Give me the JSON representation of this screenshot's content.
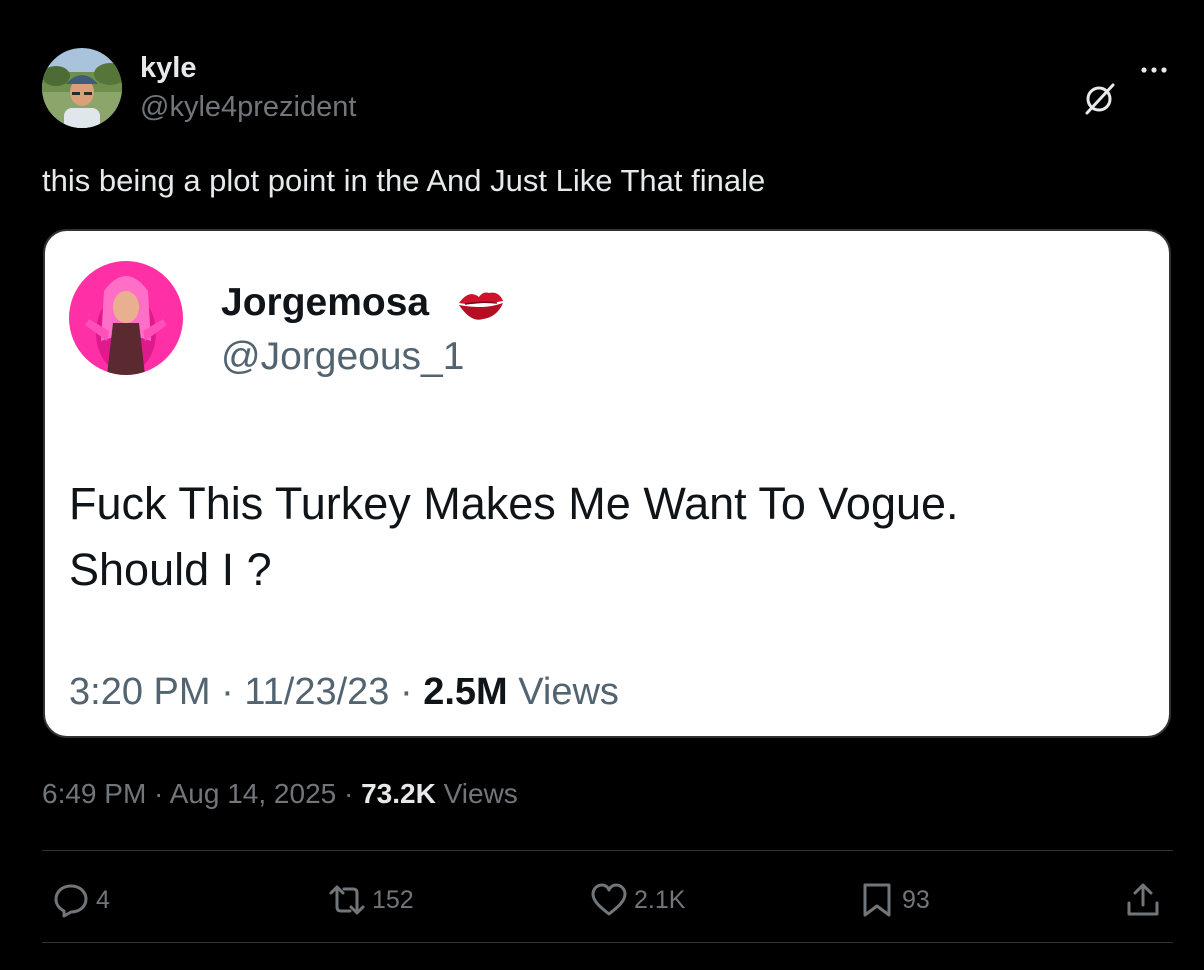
{
  "author": {
    "name": "kyle",
    "handle": "@kyle4prezident"
  },
  "tweet": {
    "text": "this being a plot point in the And Just Like That finale"
  },
  "quoted": {
    "name": "Jorgemosa",
    "handle": "@Jorgeous_1",
    "text_line1": "Fuck This Turkey Makes Me Want To Vogue.",
    "text_line2": "Should I ?",
    "time": "3:20 PM",
    "date": "11/23/23",
    "views_count": "2.5M",
    "views_label": "Views"
  },
  "meta": {
    "time": "6:49 PM",
    "date": "Aug 14, 2025",
    "views_count": "73.2K",
    "views_label": "Views",
    "separator": " · "
  },
  "actions": {
    "replies": "4",
    "reposts": "152",
    "likes": "2.1K",
    "bookmarks": "93"
  },
  "icons": [
    "grok-icon",
    "more-icon",
    "kiss-icon",
    "reply-icon",
    "repost-icon",
    "like-icon",
    "bookmark-icon",
    "share-icon"
  ],
  "colors": {
    "background": "#000000",
    "primary_text": "#e7e9ea",
    "secondary_text": "#71767b",
    "card_background": "#ffffff",
    "card_secondary_text": "#536471",
    "kiss": "#d0112b"
  }
}
